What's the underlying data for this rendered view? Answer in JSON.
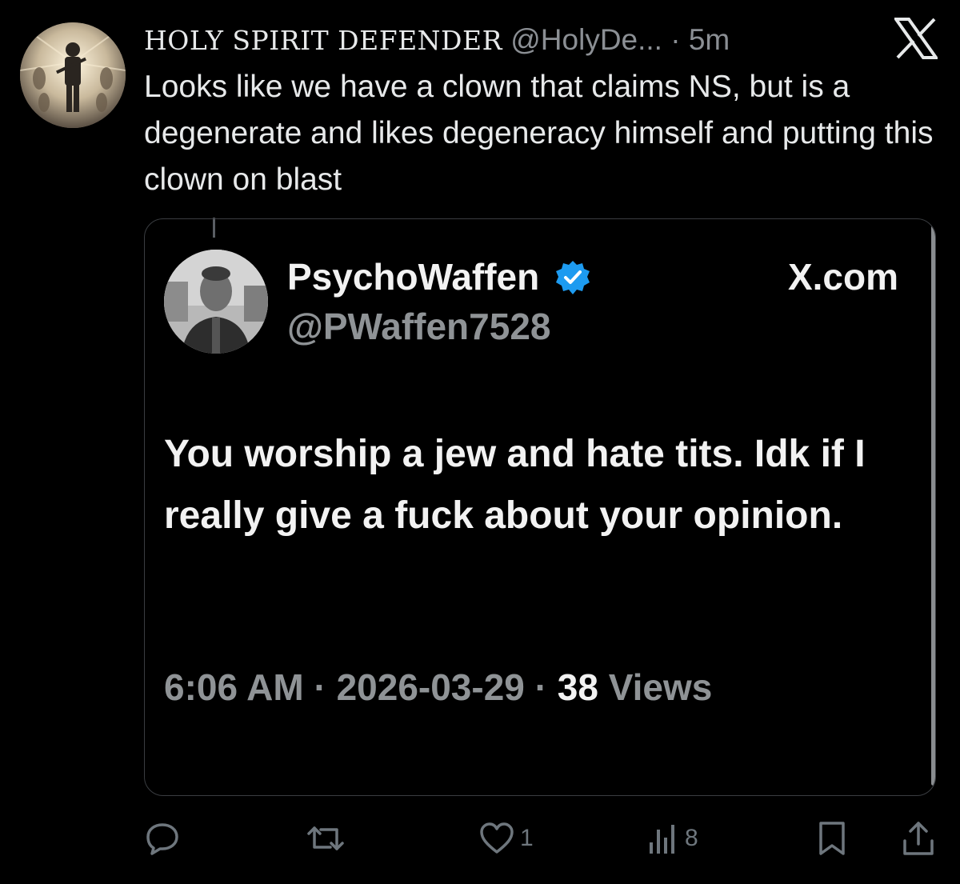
{
  "tweet": {
    "author": {
      "display_name": "HOLY SPIRIT DEFENDER",
      "handle": "@HolyDe...",
      "avatar": "avatar-soldier-image"
    },
    "separator": "·",
    "time": "5m",
    "platform_icon": "x-logo-icon",
    "text": "Looks like we have a clown that claims NS, but is a degenerate and likes degeneracy himself and putting this clown on blast"
  },
  "quote": {
    "author": {
      "display_name": "PsychoWaffen",
      "handle": "@PWaffen7528",
      "verified_icon": "verified-badge-icon",
      "avatar": "avatar-man-photo"
    },
    "source": "X.com",
    "text": "You worship a jew and hate tits. Idk if I really give a fuck about your opinion.",
    "meta": {
      "time": "6:06 AM",
      "sep1": " · ",
      "date": "2026-03-29",
      "sep2": " · ",
      "views_count": "38",
      "views_label": " Views"
    }
  },
  "actions": {
    "reply": {
      "icon": "reply-icon",
      "count": ""
    },
    "repost": {
      "icon": "repost-icon",
      "count": ""
    },
    "like": {
      "icon": "heart-icon",
      "count": "1"
    },
    "views": {
      "icon": "views-chart-icon",
      "count": "8"
    },
    "bookmark": {
      "icon": "bookmark-icon"
    },
    "share": {
      "icon": "share-icon"
    }
  },
  "colors": {
    "background": "#000000",
    "text_primary": "#e7e9ea",
    "text_secondary": "#6e767d",
    "verified_blue": "#1d9bf0",
    "card_border": "#3a3d41"
  }
}
